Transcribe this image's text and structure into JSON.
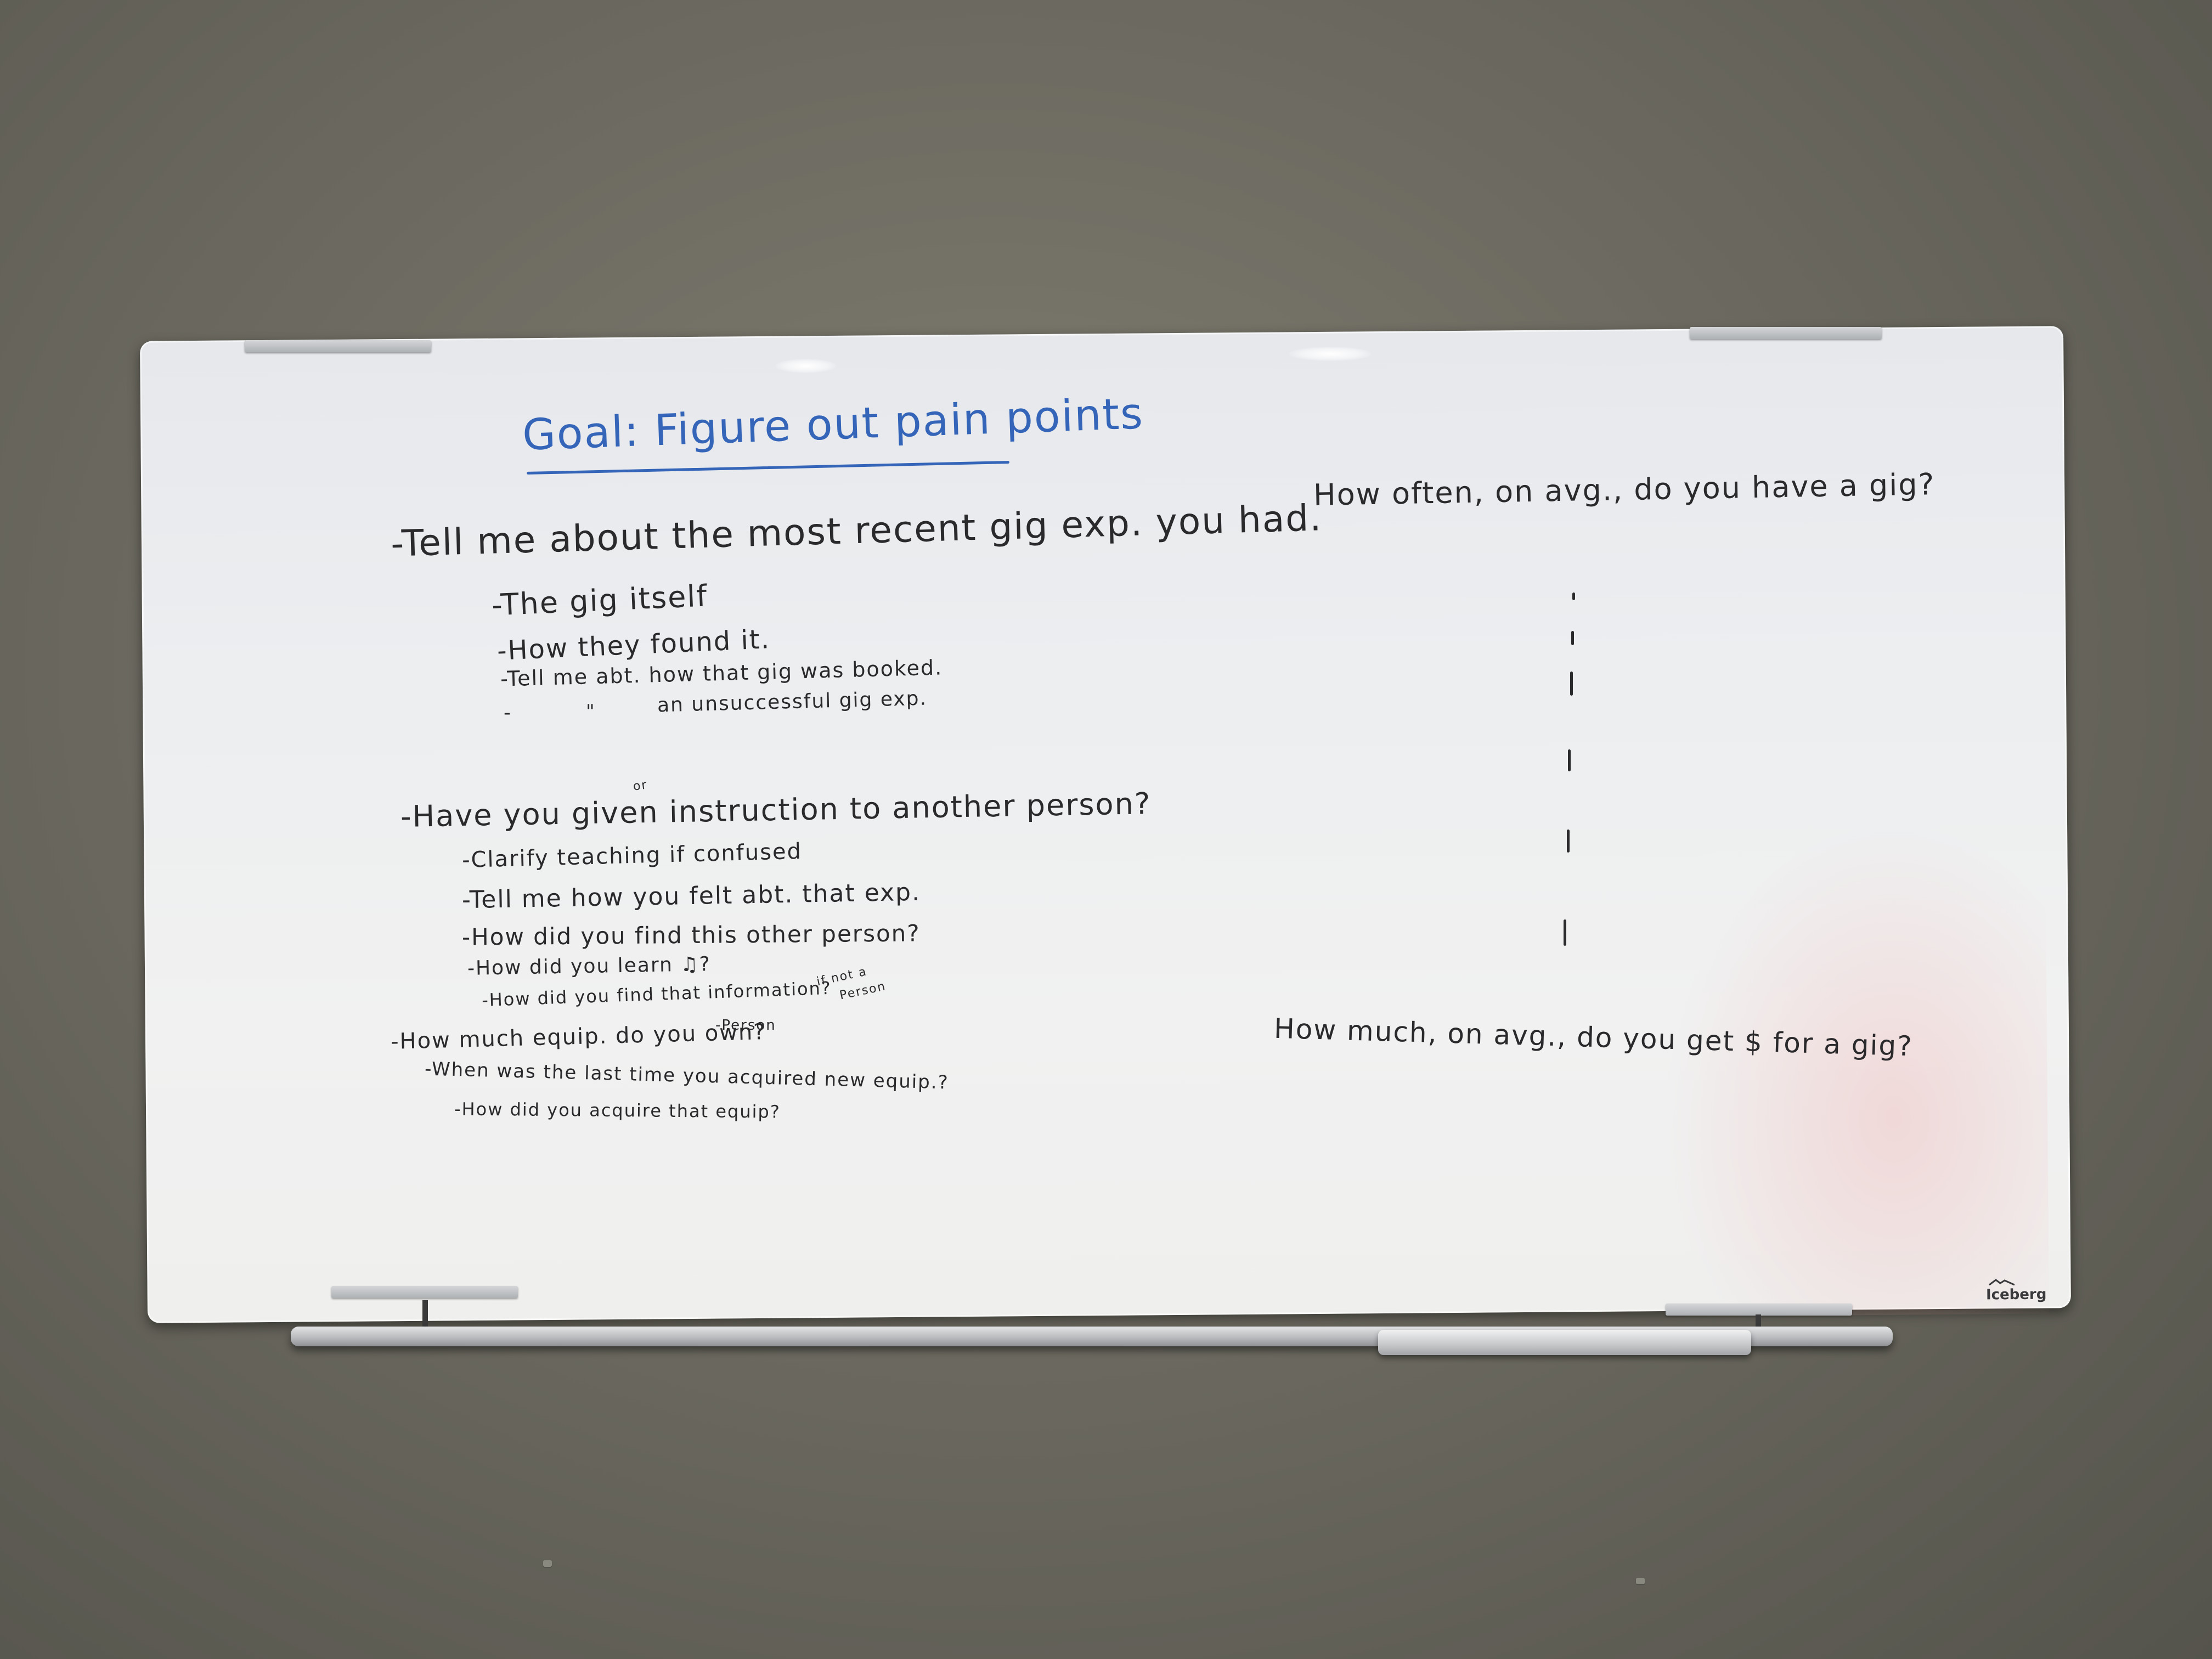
{
  "heading": "Goal: Figure out pain points",
  "left_column": {
    "q1": "-Tell me about the most recent gig exp. you had.",
    "q1_subs": [
      "-The gig itself",
      "-How they found it.",
      "-Tell me abt. how that gig was booked.",
      "-",
      "\"",
      "an unsuccessful gig exp."
    ],
    "q2": "-Have you given instruction to another person?",
    "q2_insert": "or",
    "q2_subs": [
      "-Clarify teaching if confused",
      "-Tell me how you felt abt. that exp.",
      "-How did you find this other person?",
      "-How did you learn ♫?",
      "-How did you find that information?"
    ],
    "q2_note_top": "if not a",
    "q2_note_bottom": "Person",
    "q2_note_under": "-Person",
    "q3": "-How much equip. do you own?",
    "q3_subs": [
      "-When was the last time you acquired new equip.?",
      "-How did you acquire that equip?"
    ]
  },
  "right_column": {
    "q_top": "How often, on avg., do you have a gig?",
    "q_bottom": "How much, on avg., do you get $ for a gig?"
  },
  "brand": "Iceberg",
  "colors": {
    "marker_black": "#2a2a2c",
    "marker_blue": "#3565b8",
    "wall": "#6d6b61",
    "board": "#eceef0"
  }
}
